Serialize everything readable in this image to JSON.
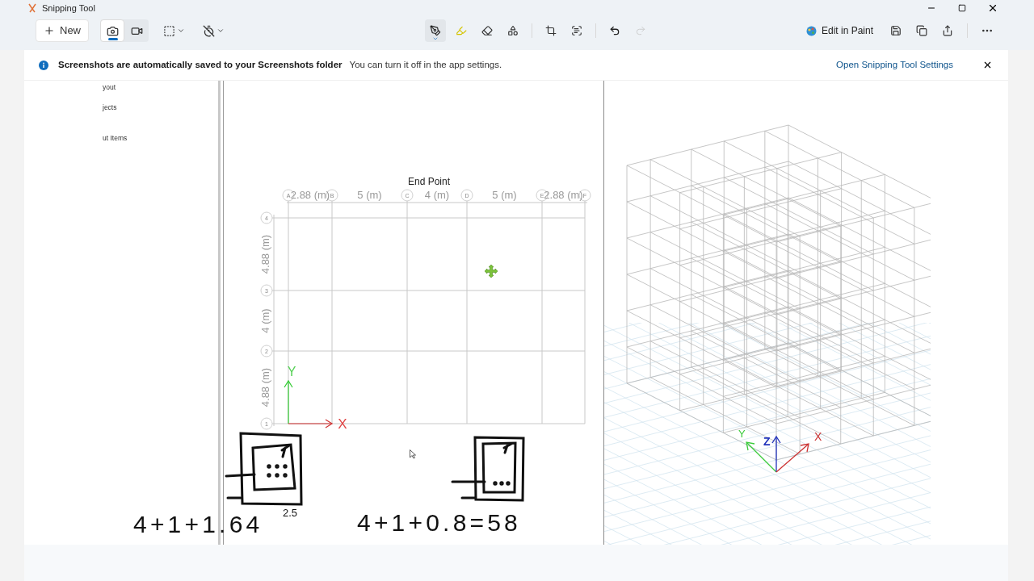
{
  "window": {
    "title": "Snipping Tool"
  },
  "toolbar": {
    "new_button": "New",
    "capture_modes": [
      {
        "kind": "photo",
        "selected": true
      },
      {
        "kind": "video",
        "selected": false
      }
    ],
    "tools": [
      {
        "kind": "pen",
        "selected": true
      },
      {
        "kind": "highlighter",
        "selected": false
      },
      {
        "kind": "eraser",
        "selected": false
      },
      {
        "kind": "shapes",
        "selected": false
      }
    ],
    "history": [
      {
        "kind": "undo",
        "disabled": false
      },
      {
        "kind": "redo",
        "disabled": true
      }
    ],
    "edit_in_paint": "Edit in Paint"
  },
  "notification": {
    "title": "Screenshots are automatically saved to your Screenshots folder",
    "message": "You can turn it off in the app settings.",
    "link": "Open Snipping Tool Settings"
  },
  "capture": {
    "side_panel_items": [
      "yout",
      "jects",
      "ut Items"
    ],
    "plan_view": {
      "column_bubbles": [
        "A",
        "B",
        "C",
        "D",
        "E",
        "F"
      ],
      "span_labels": [
        "2.88 (m)",
        "5 (m)",
        "4 (m)",
        "5 (m)",
        "2.88 (m)"
      ],
      "row_bubbles": [
        "4",
        "3",
        "2",
        "1"
      ],
      "story_labels": [
        "4.88 (m)",
        "4 (m)",
        "4.88 (m)"
      ],
      "tooltip": "End Point",
      "axis_labels": [
        "Y",
        "X"
      ]
    },
    "model_view": {
      "axis_labels": [
        "Y",
        "Z",
        "X"
      ]
    }
  },
  "ink": {
    "texts": [
      "4+1+1.64",
      "2.5",
      "4+1+0.8=58"
    ]
  }
}
